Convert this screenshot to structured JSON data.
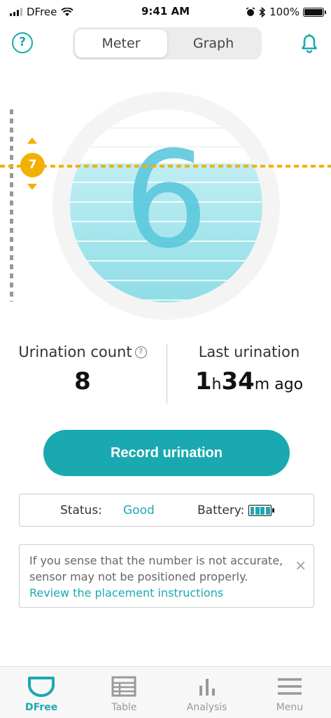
{
  "status_bar": {
    "carrier": "DFree",
    "time": "9:41 AM",
    "battery": "100%"
  },
  "header": {
    "help_icon": "question-circle-icon",
    "tabs": [
      {
        "label": "Meter",
        "active": true
      },
      {
        "label": "Graph",
        "active": false
      }
    ],
    "bell_icon": "bell-icon"
  },
  "meter": {
    "level": "6",
    "threshold": "7",
    "colors": {
      "accent": "#1aa9b0",
      "threshold": "#f2b100",
      "fill": "#8fdde6"
    }
  },
  "stats": {
    "count_label": "Urination count",
    "count_value": "8",
    "last_label": "Last urination",
    "last_hours": "1",
    "last_h_unit": "h",
    "last_minutes": "34",
    "last_m_unit": "m ago"
  },
  "record_button": {
    "label": "Record urination"
  },
  "device_status": {
    "status_label": "Status:",
    "status_value": "Good",
    "battery_label": "Battery:"
  },
  "notice": {
    "text": "If you sense that the number is not accurate, sensor may not be positioned properly.",
    "link": "Review the placement instructions"
  },
  "tabbar": [
    {
      "label": "DFree",
      "icon": "dfree-icon",
      "active": true
    },
    {
      "label": "Table",
      "icon": "table-icon",
      "active": false
    },
    {
      "label": "Analysis",
      "icon": "bar-chart-icon",
      "active": false
    },
    {
      "label": "Menu",
      "icon": "menu-icon",
      "active": false
    }
  ]
}
